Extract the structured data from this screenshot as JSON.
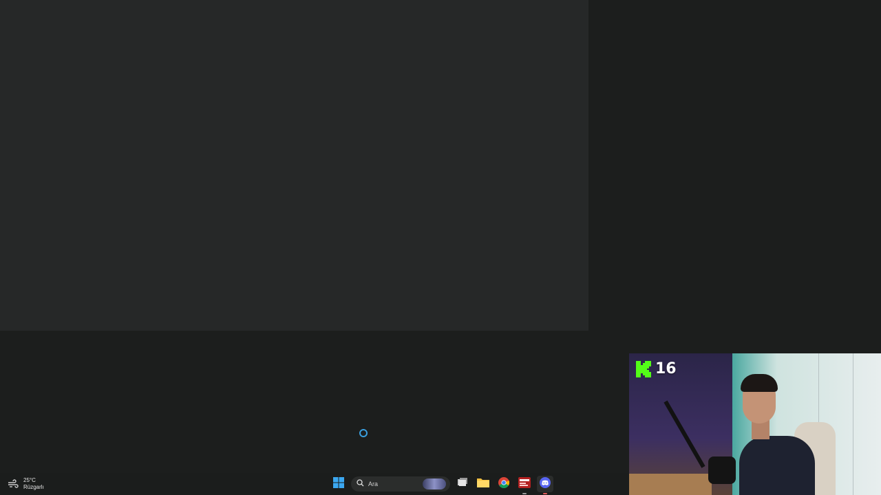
{
  "taskbar": {
    "weather": {
      "temperature": "25°C",
      "condition": "Rüzgarlı",
      "icon": "wind-icon"
    },
    "search": {
      "placeholder": "Ara",
      "icon": "search-icon"
    },
    "apps": [
      {
        "name": "windows-start",
        "icon": "windows-logo-icon"
      },
      {
        "name": "task-view",
        "icon": "task-view-icon"
      },
      {
        "name": "file-explorer",
        "icon": "folder-icon"
      },
      {
        "name": "chrome",
        "icon": "chrome-icon"
      },
      {
        "name": "unknown-app",
        "icon": "app-icon"
      },
      {
        "name": "discord",
        "icon": "discord-icon"
      }
    ]
  },
  "webcam": {
    "platform_icon": "kick-logo-icon",
    "viewer_count": "16",
    "brand_color": "#53fc18"
  },
  "colors": {
    "desktop_bg": "#1c1e1d",
    "window_bg": "#262828",
    "loading_spinner": "#3aa0e0"
  }
}
